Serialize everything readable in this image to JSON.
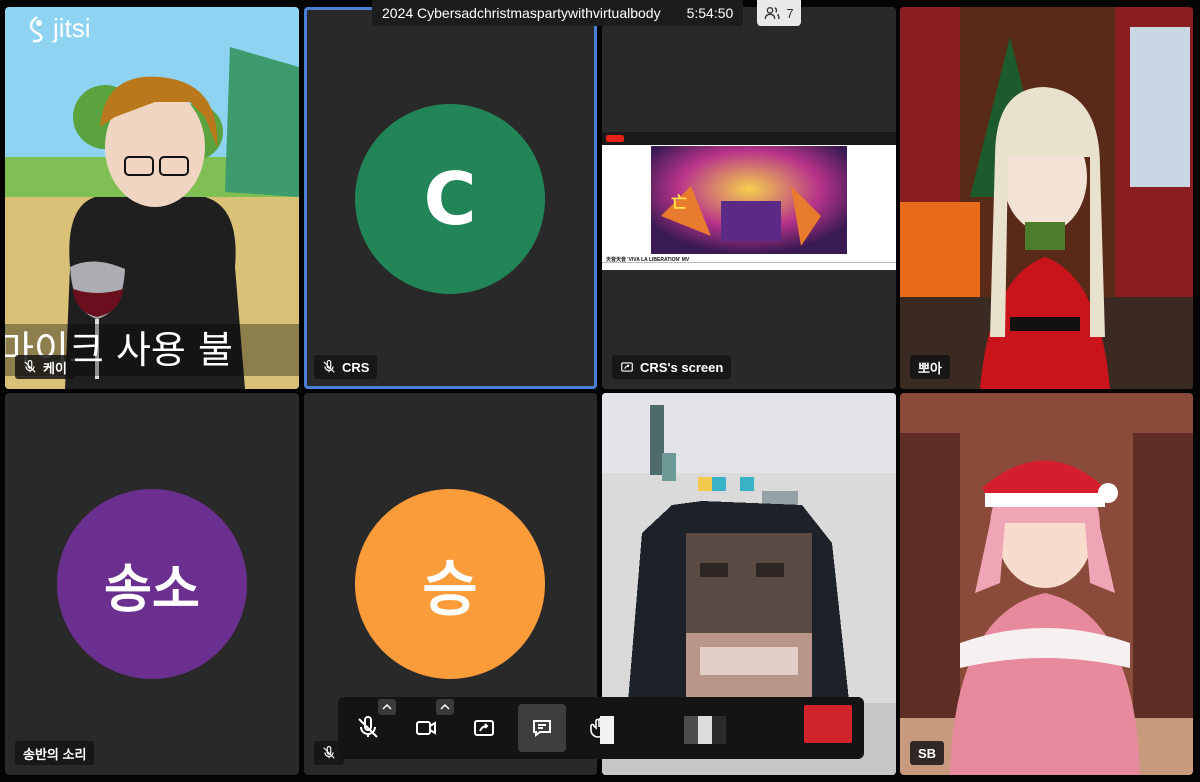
{
  "app": {
    "logo_text": "jitsi"
  },
  "meeting": {
    "title": "2024 Cybersadchristmaspartywithvirtualbody",
    "duration": "5:54:50",
    "participant_count": "7"
  },
  "tiles": {
    "kei": {
      "name": "케이",
      "overlay_text": "마이크 사용 불"
    },
    "crs": {
      "name": "CRS",
      "initial": "C",
      "color": "#228557"
    },
    "crs_screen": {
      "name": "CRS's screen",
      "shared_video_title": "天音天音 'VIVA LA LIBERATION' MV"
    },
    "ppoa": {
      "name": "뽀아"
    },
    "songbanui": {
      "name": "송반의 소리",
      "initial": "송소",
      "color": "#6b2f8f"
    },
    "seung": {
      "initial": "승",
      "color": "#fb9c3a"
    },
    "sb": {
      "name": "SB"
    }
  },
  "colors": {
    "tile_bg": "#292929",
    "active_border": "#4a7fd6",
    "hangup": "#d1232c"
  },
  "toolbar": {
    "buttons": [
      "microphone-muted-icon",
      "camera-icon",
      "share-screen-icon",
      "chat-icon",
      "raise-hand-icon"
    ]
  }
}
